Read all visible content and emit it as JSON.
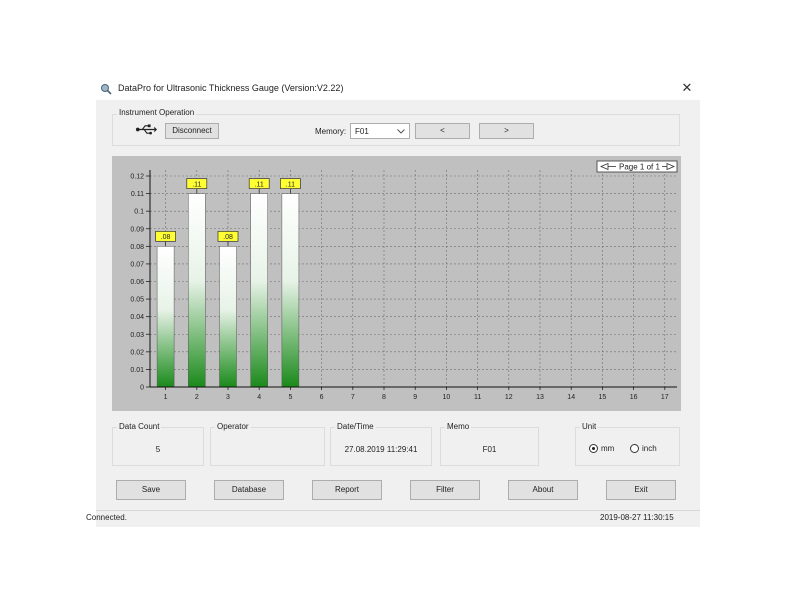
{
  "window": {
    "title": "DataPro for Ultrasonic Thickness Gauge (Version:V2.22)"
  },
  "instrument": {
    "group_label": "Instrument Operation",
    "usb_icon": "usb-icon",
    "disconnect_label": "Disconnect",
    "memory_label": "Memory:",
    "memory_value": "F01",
    "prev_label": "<",
    "next_label": ">"
  },
  "pager": {
    "text": "Page 1 of 1"
  },
  "chart_data": {
    "type": "bar",
    "categories": [
      "1",
      "2",
      "3",
      "4",
      "5",
      "6",
      "7",
      "8",
      "9",
      "10",
      "11",
      "12",
      "13",
      "14",
      "15",
      "16",
      "17"
    ],
    "values": [
      0.08,
      0.11,
      0.08,
      0.11,
      0.11,
      null,
      null,
      null,
      null,
      null,
      null,
      null,
      null,
      null,
      null,
      null,
      null
    ],
    "data_labels": [
      ".08",
      ".11",
      ".08",
      ".11",
      ".11"
    ],
    "y_ticks": [
      "0",
      "0.01",
      "0.02",
      "0.03",
      "0.04",
      "0.05",
      "0.06",
      "0.07",
      "0.08",
      "0.09",
      "0.1",
      "0.11",
      "0.12"
    ],
    "ylim": [
      0,
      0.12
    ],
    "grid": true,
    "colors": {
      "bar_top": "#ffffff",
      "bar_bottom": "#1a8a1a",
      "label_bg": "#ffff33",
      "plot_bg": "#c0c0c0"
    }
  },
  "info": {
    "data_count_label": "Data Count",
    "data_count_value": "5",
    "operator_label": "Operator",
    "operator_value": "",
    "datetime_label": "Date/Time",
    "datetime_value": "27.08.2019 11:29:41",
    "memo_label": "Memo",
    "memo_value": "F01",
    "unit_label": "Unit",
    "unit_mm": "mm",
    "unit_inch": "inch",
    "unit_selected": "mm"
  },
  "buttons": {
    "save": "Save",
    "database": "Database",
    "report": "Report",
    "filter": "Filter",
    "about": "About",
    "exit": "Exit"
  },
  "statusbar": {
    "status": "Connected.",
    "timestamp": "2019-08-27 11:30:15"
  }
}
